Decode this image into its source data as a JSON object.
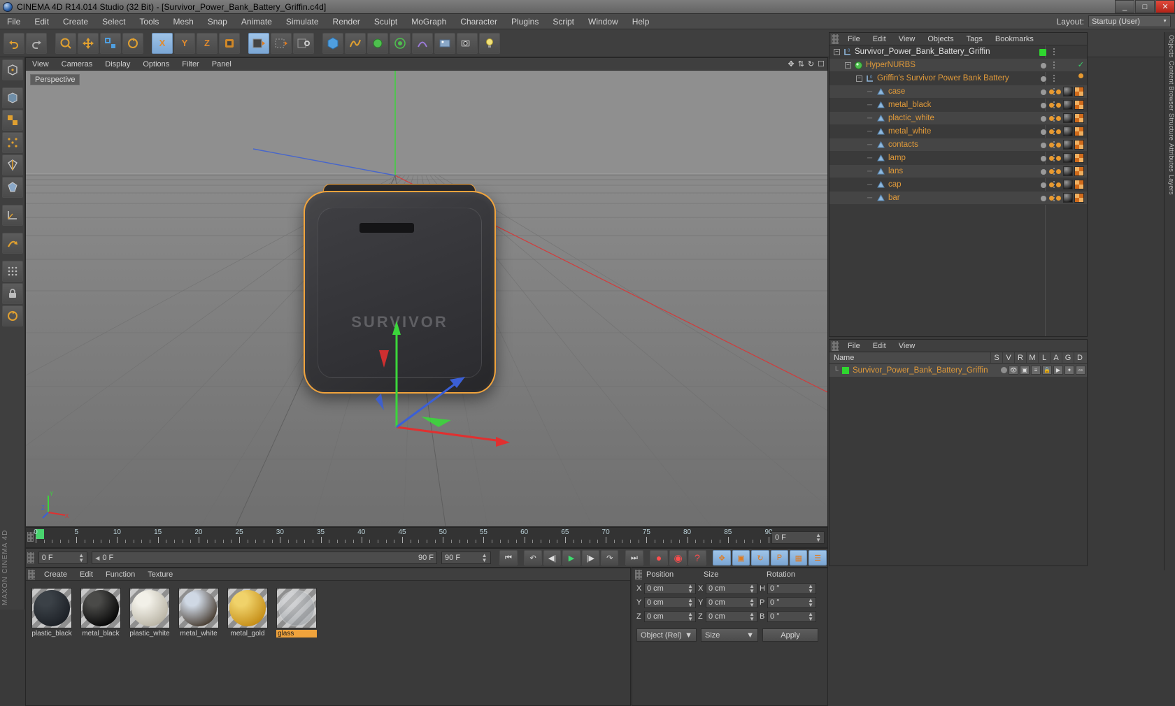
{
  "window": {
    "title": "CINEMA 4D R14.014 Studio (32 Bit) - [Survivor_Power_Bank_Battery_Griffin.c4d]",
    "minimize": "_",
    "maximize": "□",
    "close": "✕"
  },
  "menubar": {
    "items": [
      "File",
      "Edit",
      "Create",
      "Select",
      "Tools",
      "Mesh",
      "Snap",
      "Animate",
      "Simulate",
      "Render",
      "Sculpt",
      "MoGraph",
      "Character",
      "Plugins",
      "Script",
      "Window",
      "Help"
    ],
    "layout_label": "Layout:",
    "layout_value": "Startup (User)"
  },
  "viewport": {
    "menu": [
      "View",
      "Cameras",
      "Display",
      "Options",
      "Filter",
      "Panel"
    ],
    "perspective_badge": "Perspective",
    "axis_labels": {
      "x": "X",
      "y": "Y",
      "z": "Z"
    },
    "product_logo": "SURVIVOR"
  },
  "timeline": {
    "ticks": [
      0,
      5,
      10,
      15,
      20,
      25,
      30,
      35,
      40,
      45,
      50,
      55,
      60,
      65,
      70,
      75,
      80,
      85,
      90
    ],
    "end_value": "0 F",
    "current_frame": "0 F",
    "range_value": "0 F",
    "max_frame": "90 F",
    "preview_end": "90 F"
  },
  "material_manager": {
    "menu": [
      "Create",
      "Edit",
      "Function",
      "Texture"
    ],
    "materials": [
      {
        "name": "plastic_black",
        "color1": "#3b4147",
        "color2": "#1c2026",
        "selected": false
      },
      {
        "name": "metal_black",
        "color1": "#4a4a48",
        "color2": "#070707",
        "selected": false
      },
      {
        "name": "plastic_white",
        "color1": "#f2f0e8",
        "color2": "#bab5a6",
        "selected": false
      },
      {
        "name": "metal_white",
        "color1": "#cfd8e4",
        "color2": "#4a3f34",
        "selected": false
      },
      {
        "name": "metal_gold",
        "color1": "#f0d26a",
        "color2": "#c58e18",
        "selected": false
      },
      {
        "name": "glass",
        "color1": "#d8dadd",
        "color2": "#9aa0a6",
        "selected": true
      }
    ]
  },
  "coordinates": {
    "headers": {
      "position": "Position",
      "size": "Size",
      "rotation": "Rotation"
    },
    "position": {
      "x": "0 cm",
      "y": "0 cm",
      "z": "0 cm"
    },
    "size": {
      "x": "0 cm",
      "y": "0 cm",
      "z": "0 cm"
    },
    "rotation": {
      "h": "0 °",
      "p": "0 °",
      "b": "0 °"
    },
    "axis_labels": {
      "x": "X",
      "y": "Y",
      "z": "Z",
      "h": "H",
      "p": "P",
      "b": "B"
    },
    "mode_select": "Object (Rel)",
    "size_select": "Size",
    "apply_label": "Apply"
  },
  "object_manager": {
    "menu": [
      "File",
      "Edit",
      "View",
      "Objects",
      "Tags",
      "Bookmarks"
    ],
    "rows": [
      {
        "label": "Survivor_Power_Bank_Battery_Griffin",
        "depth": 0,
        "icon": "null-object-icon",
        "expander": "−",
        "dot": "green",
        "tags": [],
        "check": false
      },
      {
        "label": "HyperNURBS",
        "depth": 1,
        "icon": "hypernurbs-icon",
        "expander": "−",
        "dot": "grey",
        "tags": [],
        "check": true
      },
      {
        "label": "Griffin's Survivor Power Bank Battery",
        "depth": 2,
        "icon": "null-object-icon",
        "expander": "−",
        "dot": "grey",
        "tags": [
          "mat"
        ],
        "check": false
      },
      {
        "label": "case",
        "depth": 3,
        "icon": "polygon-object-icon",
        "expander": "",
        "dot": "grey",
        "tags": [
          "mat",
          "mat"
        ],
        "check": false
      },
      {
        "label": "metal_black",
        "depth": 3,
        "icon": "polygon-object-icon",
        "expander": "",
        "dot": "grey",
        "tags": [
          "mat",
          "mat"
        ],
        "check": false
      },
      {
        "label": "plactic_white",
        "depth": 3,
        "icon": "polygon-object-icon",
        "expander": "",
        "dot": "grey",
        "tags": [
          "mat",
          "mat"
        ],
        "check": false
      },
      {
        "label": "metal_white",
        "depth": 3,
        "icon": "polygon-object-icon",
        "expander": "",
        "dot": "grey",
        "tags": [
          "mat",
          "mat"
        ],
        "check": false
      },
      {
        "label": "contacts",
        "depth": 3,
        "icon": "polygon-object-icon",
        "expander": "",
        "dot": "grey",
        "tags": [
          "mat",
          "mat"
        ],
        "check": false
      },
      {
        "label": "lamp",
        "depth": 3,
        "icon": "polygon-object-icon",
        "expander": "",
        "dot": "grey",
        "tags": [
          "mat",
          "mat"
        ],
        "check": false
      },
      {
        "label": "lans",
        "depth": 3,
        "icon": "polygon-object-icon",
        "expander": "",
        "dot": "grey",
        "tags": [
          "mat",
          "mat"
        ],
        "check": false
      },
      {
        "label": "cap",
        "depth": 3,
        "icon": "polygon-object-icon",
        "expander": "",
        "dot": "grey",
        "tags": [
          "mat",
          "mat"
        ],
        "check": false
      },
      {
        "label": "bar",
        "depth": 3,
        "icon": "polygon-object-icon",
        "expander": "",
        "dot": "grey",
        "tags": [
          "mat",
          "mat"
        ],
        "check": false
      }
    ]
  },
  "attribute_manager": {
    "menu": [
      "File",
      "Edit",
      "View"
    ],
    "name_header": "Name",
    "columns": [
      "S",
      "V",
      "R",
      "M",
      "L",
      "A",
      "G",
      "D"
    ],
    "row_label": "Survivor_Power_Bank_Battery_Griffin"
  },
  "right_tabs": [
    "Objects",
    "Content Browser",
    "Structure",
    "Attributes",
    "Layers"
  ],
  "brand": "MAXON CINEMA 4D",
  "colors": {
    "accent_orange": "#e09a3a",
    "selection_green": "#2fd62f",
    "axis_x": "#e03030",
    "axis_y": "#3bd63b",
    "axis_z": "#3b5fd6",
    "panel_bg": "#3a3a3a",
    "toolbar_bg": "#3f3f3f"
  }
}
